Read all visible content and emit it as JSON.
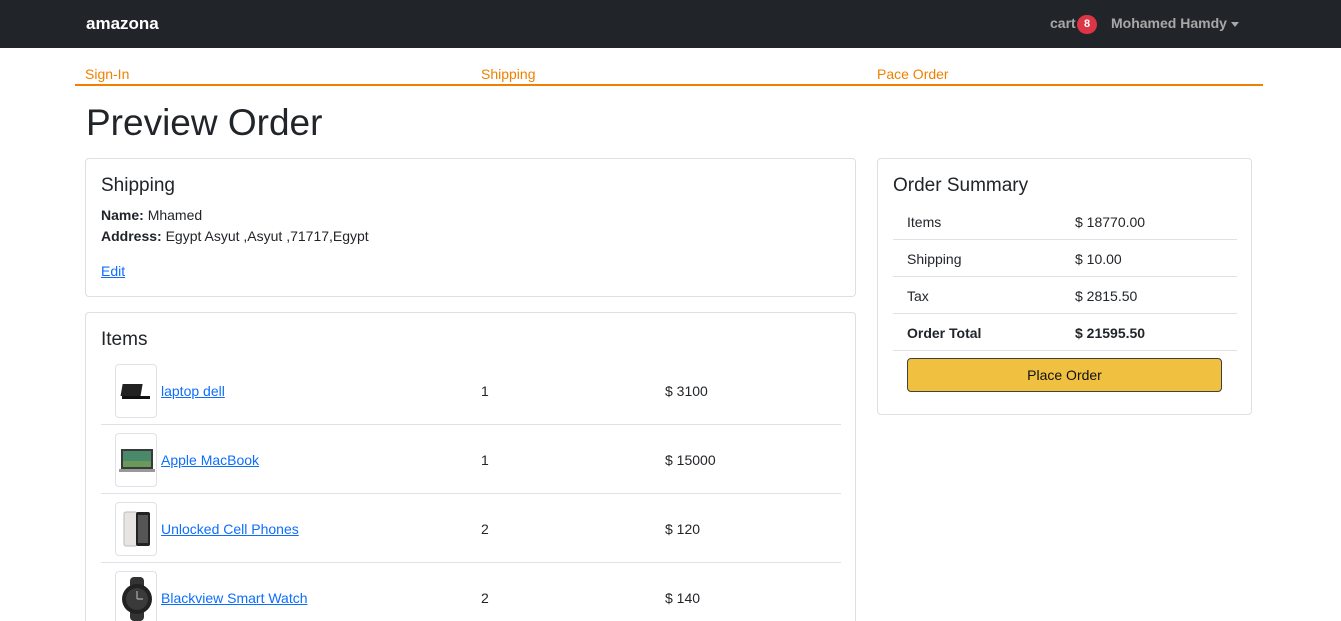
{
  "navbar": {
    "brand": "amazona",
    "cart_label": "cart",
    "cart_count": "8",
    "user_name": "Mohamed Hamdy"
  },
  "steps": [
    "Sign-In",
    "Shipping",
    "Pace Order"
  ],
  "page_title": "Preview Order",
  "shipping": {
    "title": "Shipping",
    "name_label": "Name:",
    "name_value": "Mhamed",
    "address_label": "Address:",
    "address_value": "Egypt Asyut ,Asyut ,71717,Egypt",
    "edit_label": "Edit"
  },
  "items": {
    "title": "Items",
    "rows": [
      {
        "name": "laptop dell",
        "qty": "1",
        "price": "$ 3100"
      },
      {
        "name": "Apple MacBook",
        "qty": "1",
        "price": "$ 15000"
      },
      {
        "name": "Unlocked Cell Phones",
        "qty": "2",
        "price": "$ 120"
      },
      {
        "name": "Blackview Smart Watch",
        "qty": "2",
        "price": "$ 140"
      }
    ]
  },
  "summary": {
    "title": "Order Summary",
    "rows": [
      {
        "label": "Items",
        "value": "$ 18770.00"
      },
      {
        "label": "Shipping",
        "value": "$ 10.00"
      },
      {
        "label": "Tax",
        "value": "$ 2815.50"
      },
      {
        "label": "Order Total",
        "value": "$ 21595.50"
      }
    ],
    "button_label": "Place Order"
  },
  "colors": {
    "navbar_bg": "#212529",
    "step_accent": "#f08000",
    "link": "#0d6efd",
    "button_bg": "#f0c040",
    "badge": "#dc3545"
  }
}
